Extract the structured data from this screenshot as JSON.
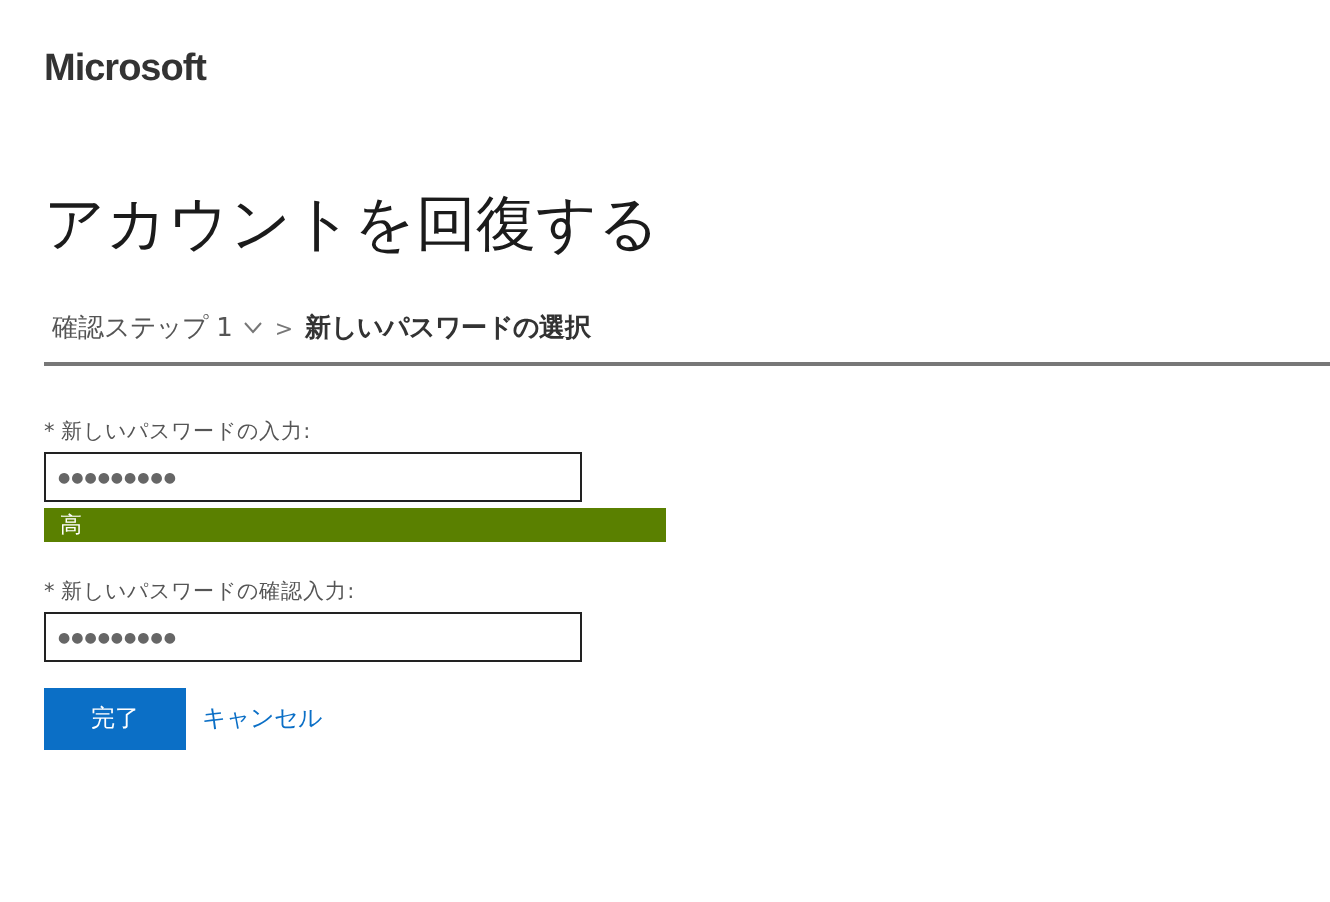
{
  "brand": "Microsoft",
  "title": "アカウントを回復する",
  "breadcrumb": [
    {
      "label": "確認ステップ 1",
      "kind": "dropdown",
      "current": false
    },
    {
      "label": "新しいパスワードの選択",
      "kind": "plain",
      "current": true
    }
  ],
  "breadcrumb_separator": ">",
  "fields": [
    {
      "label": "* 新しいパスワードの入力:",
      "value": "●●●●●●●●●",
      "strength": {
        "label": "高",
        "level": 1
      }
    },
    {
      "label": "* 新しいパスワードの確認入力:",
      "value": "●●●●●●●●●"
    }
  ],
  "buttons": {
    "primary": "完了",
    "link": "キャンセル"
  }
}
